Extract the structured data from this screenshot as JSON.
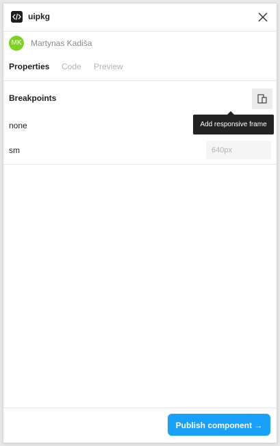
{
  "app": {
    "title": "uipkg",
    "logo_icon": "code-icon"
  },
  "user": {
    "initials": "MK",
    "name": "Martynas Kadiša",
    "avatar_color": "#7ed321"
  },
  "tabs": [
    {
      "label": "Properties",
      "active": true
    },
    {
      "label": "Code",
      "active": false
    },
    {
      "label": "Preview",
      "active": false
    }
  ],
  "breakpoints": {
    "title": "Breakpoints",
    "add_button_icon": "responsive-frame-icon",
    "tooltip": "Add responsive frame",
    "rows": [
      {
        "label": "none",
        "placeholder": ""
      },
      {
        "label": "sm",
        "placeholder": "640px"
      }
    ]
  },
  "footer": {
    "publish_label": "Publish component →",
    "accent": "#18a0fb"
  }
}
